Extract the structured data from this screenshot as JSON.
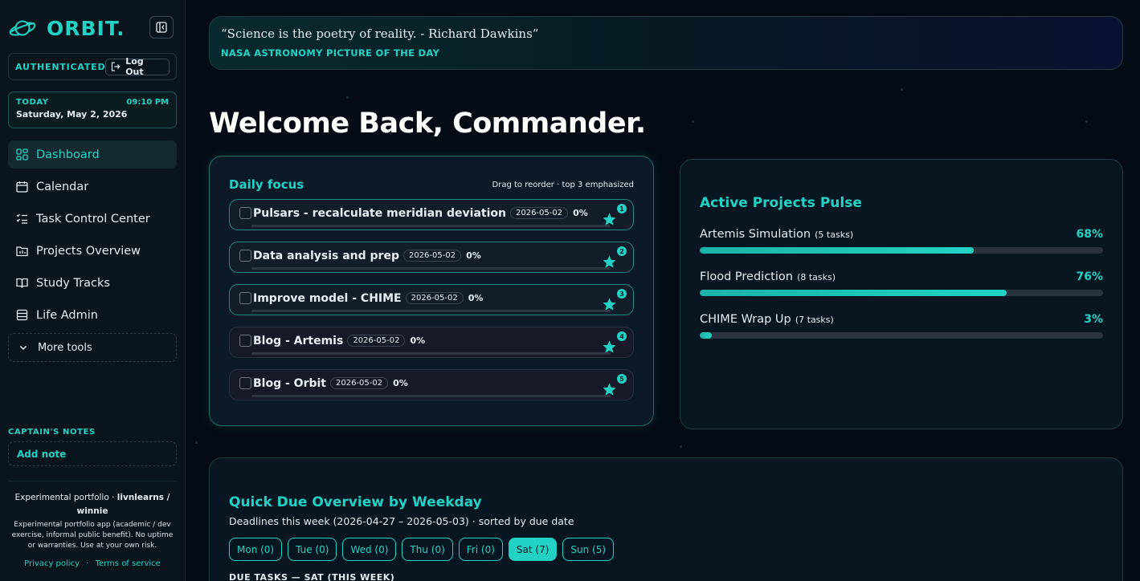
{
  "brand": {
    "name": "ORBIT."
  },
  "auth": {
    "status": "AUTHENTICATED",
    "logout_label": "Log Out"
  },
  "today": {
    "label": "TODAY",
    "time": "09:10 PM",
    "date": "Saturday, May 2, 2026"
  },
  "nav": {
    "items": [
      {
        "label": "Dashboard",
        "icon": "dashboard-icon",
        "active": true
      },
      {
        "label": "Calendar",
        "icon": "calendar-icon"
      },
      {
        "label": "Task Control Center",
        "icon": "task-list-icon"
      },
      {
        "label": "Projects Overview",
        "icon": "projects-icon"
      },
      {
        "label": "Study Tracks",
        "icon": "book-icon"
      },
      {
        "label": "Life Admin",
        "icon": "admin-icon"
      }
    ],
    "more_tools": "More tools"
  },
  "notes": {
    "label": "CAPTAIN'S NOTES",
    "add_label": "Add note"
  },
  "footer": {
    "title_prefix": "Experimental portfolio ·",
    "title_handle": "livnlearns / winnie",
    "text": "Experimental portfolio app (academic / dev exercise, informal public benefit). No uptime or warranties. Use at your own risk.",
    "privacy": "Privacy policy",
    "separator": "·",
    "terms": "Terms of service"
  },
  "quote": {
    "text": "“Science is the poetry of reality. - Richard Dawkins”",
    "source": "NASA ASTRONOMY PICTURE OF THE DAY"
  },
  "welcome": "Welcome Back, Commander.",
  "focus": {
    "title": "Daily focus",
    "hint": "Drag to reorder · top 3 emphasized",
    "tasks": [
      {
        "name": "Pulsars - recalculate meridian deviation",
        "date": "2026-05-02",
        "pct": "0%",
        "rank": "1",
        "progress": 0
      },
      {
        "name": "Data analysis and prep",
        "date": "2026-05-02",
        "pct": "0%",
        "rank": "2",
        "progress": 0
      },
      {
        "name": "Improve model - CHIME",
        "date": "2026-05-02",
        "pct": "0%",
        "rank": "3",
        "progress": 0
      },
      {
        "name": "Blog - Artemis",
        "date": "2026-05-02",
        "pct": "0%",
        "rank": "4",
        "progress": 0
      },
      {
        "name": "Blog - Orbit",
        "date": "2026-05-02",
        "pct": "0%",
        "rank": "5",
        "progress": 0
      }
    ]
  },
  "pulse": {
    "title": "Active Projects Pulse",
    "projects": [
      {
        "name": "Artemis Simulation",
        "tasks": "(5 tasks)",
        "pct": "68%",
        "value": 68
      },
      {
        "name": "Flood Prediction",
        "tasks": "(8 tasks)",
        "pct": "76%",
        "value": 76
      },
      {
        "name": "CHIME Wrap Up",
        "tasks": "(7 tasks)",
        "pct": "3%",
        "value": 3
      }
    ]
  },
  "due": {
    "title": "Quick Due Overview by Weekday",
    "subtitle": "Deadlines this week (2026-04-27 – 2026-05-03) · sorted by due date",
    "days": [
      {
        "label": "Mon (0)",
        "active": false
      },
      {
        "label": "Tue (0)",
        "active": false
      },
      {
        "label": "Wed (0)",
        "active": false
      },
      {
        "label": "Thu (0)",
        "active": false
      },
      {
        "label": "Fri (0)",
        "active": false
      },
      {
        "label": "Sat (7)",
        "active": true
      },
      {
        "label": "Sun (5)",
        "active": false
      }
    ],
    "next_label": "DUE TASKS — SAT (THIS WEEK)"
  },
  "colors": {
    "accent": "#22d3c5",
    "background": "#050b14",
    "sidebar": "#0a141c"
  }
}
